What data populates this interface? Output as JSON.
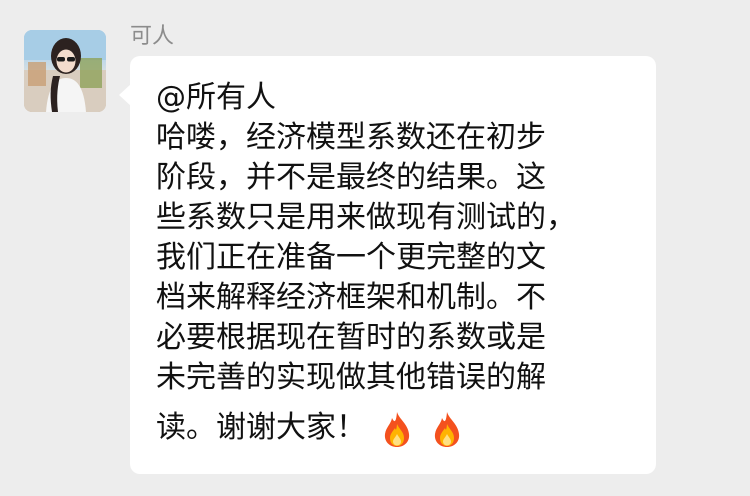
{
  "chat": {
    "sender": {
      "name": "可人",
      "avatar_icon": "profile-photo"
    },
    "message": {
      "mention": "@所有人",
      "lines": [
        "哈喽，经济模型系数还在初步",
        "阶段，并不是最终的结果。这",
        "些系数只是用来做现有测试的，",
        "我们正在准备一个更完整的文",
        "档来解释经济框架和机制。不",
        "必要根据现在暂时的系数或是",
        "未完善的实现做其他错误的解",
        "读。谢谢大家！"
      ],
      "emoji": [
        "🔥",
        "🔥"
      ]
    }
  },
  "colors": {
    "background": "#ededed",
    "bubble": "#ffffff",
    "name_text": "#8c8c8c",
    "message_text": "#111111"
  }
}
